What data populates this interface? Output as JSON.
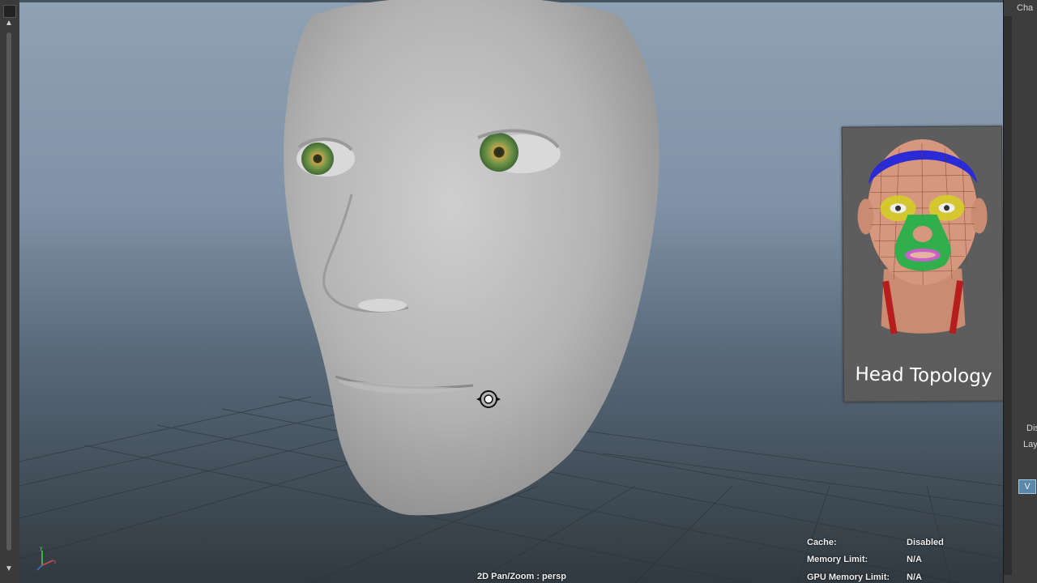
{
  "viewport": {
    "camera_label": "2D Pan/Zoom : persp",
    "stats": [
      {
        "label": "Cache:",
        "value": "Disabled"
      },
      {
        "label": "Memory Limit:",
        "value": "N/A"
      },
      {
        "label": "GPU Memory Limit:",
        "value": "N/A"
      }
    ],
    "axis": {
      "y": "y",
      "x": "x"
    }
  },
  "reference_card": {
    "title": "Head Topology"
  },
  "right_panel": {
    "tab_label": "Cha",
    "label_dis": "Dis",
    "label_lay": "Lay",
    "button_v": "V"
  },
  "icons": {
    "cursor": "pan-zoom-cursor-icon"
  },
  "colors": {
    "viewport_top": "#8fa1b4",
    "viewport_bottom": "#30393f",
    "accent_blue": "#5a86a8"
  }
}
